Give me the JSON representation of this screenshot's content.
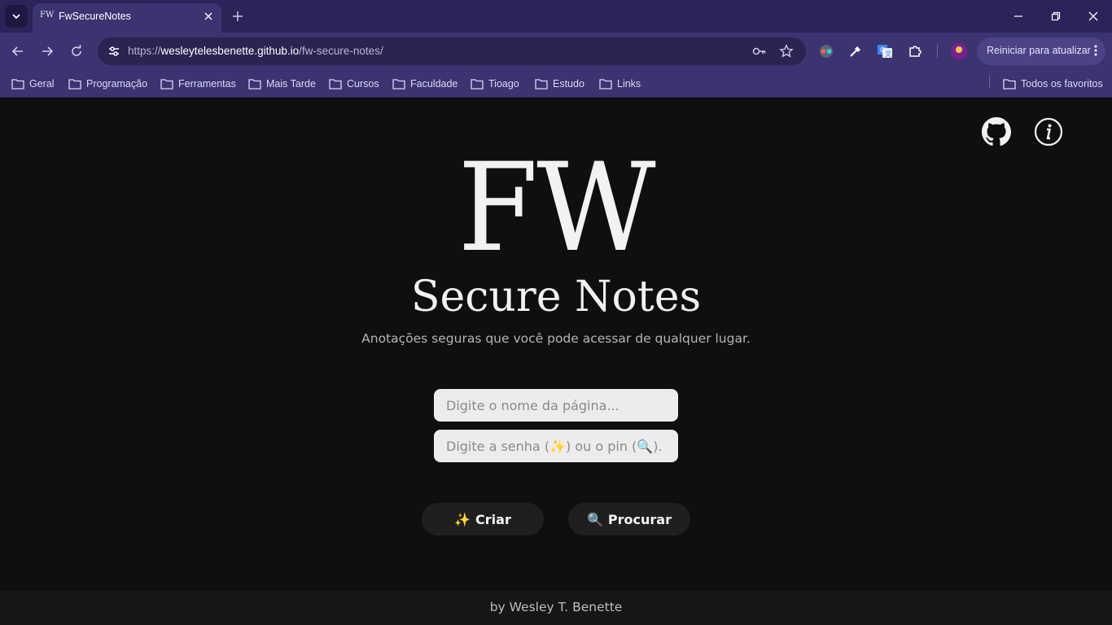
{
  "browser": {
    "tab": {
      "favicon_text": "FW",
      "title": "FwSecureNotes"
    },
    "url": {
      "scheme": "https://",
      "host": "wesleytelesbenette.github.io",
      "path": "/fw-secure-notes/"
    },
    "update_button": "Reiniciar para atualizar",
    "bookmarks": [
      "Geral",
      "Programação",
      "Ferramentas",
      "Mais Tarde",
      "Cursos",
      "Faculdade",
      "Tioago",
      "Estudo",
      "Links"
    ],
    "all_bookmarks": "Todos os favoritos"
  },
  "page": {
    "logo": "FW",
    "subtitle": "Secure Notes",
    "tagline": "Anotações seguras que você pode acessar de qualquer lugar.",
    "page_name_placeholder": "Digite o nome da página...",
    "password_placeholder": "Digite a senha (✨) ou o pin (🔍).",
    "create_button": {
      "icon": "✨",
      "label": "Criar"
    },
    "search_button": {
      "icon": "🔍",
      "label": "Procurar"
    },
    "footer": "by Wesley T. Benette"
  },
  "colors": {
    "chrome_dark": "#2b2458",
    "chrome": "#3b3470",
    "page_background": "#0f0f0f",
    "button_background": "#1f1f1f",
    "input_background": "#ececec"
  }
}
